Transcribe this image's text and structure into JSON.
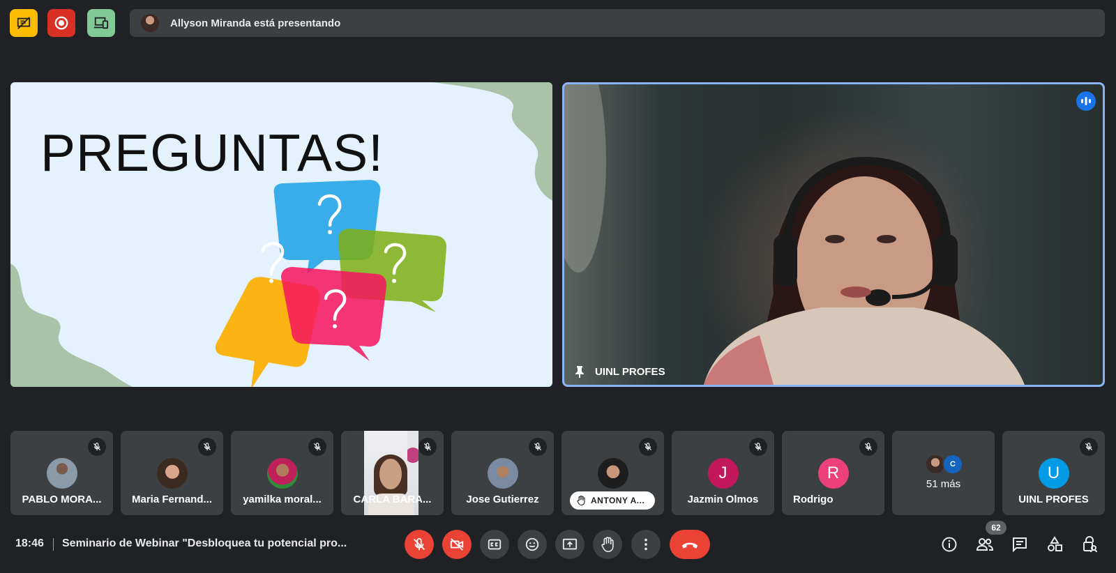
{
  "top_bar": {
    "presenting_text": "Allyson Miranda está presentando"
  },
  "slide": {
    "title": "PREGUNTAS!"
  },
  "speaker": {
    "name": "UINL PROFES"
  },
  "participants": [
    {
      "name": "PABLO MORA...",
      "type": "photo"
    },
    {
      "name": "Maria Fernand...",
      "type": "photo"
    },
    {
      "name": "yamilka moral...",
      "type": "photo"
    },
    {
      "name": "CARLA BARA...",
      "type": "video"
    },
    {
      "name": "Jose Gutierrez",
      "type": "photo"
    },
    {
      "name": "ANTONY A...",
      "type": "photo",
      "hand_raised": true
    },
    {
      "name": "Jazmin Olmos",
      "type": "initial",
      "initial": "J",
      "color": "#c2185b"
    },
    {
      "name": "Rodrigo",
      "type": "initial",
      "initial": "R",
      "color": "#ec407a"
    },
    {
      "name": "51 más",
      "type": "more",
      "mini_initial": "C"
    },
    {
      "name": "UINL PROFES",
      "type": "initial",
      "initial": "U",
      "color": "#039be5"
    }
  ],
  "bottom_bar": {
    "time": "18:46",
    "meeting_title": "Seminario de Webinar \"Desbloquea tu potencial pro...",
    "participant_count": "62"
  },
  "colors": {
    "background": "#202124",
    "tile": "#3c4043",
    "accent_red": "#ea4335",
    "accent_blue": "#8ab4f8"
  }
}
